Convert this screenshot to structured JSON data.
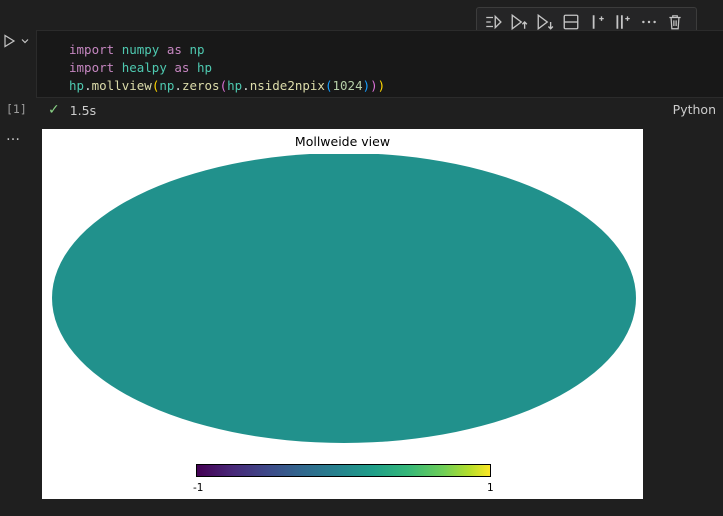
{
  "toolbar": {
    "icons": [
      "run-by-line-icon",
      "run-above-icon",
      "run-below-icon",
      "split-cell-icon",
      "add-cell-above-icon",
      "add-cell-below-icon",
      "more-icon",
      "delete-icon"
    ]
  },
  "cell": {
    "code_lines": [
      "import numpy as np",
      "import healpy as hp",
      "hp.mollview(np.zeros(hp.nside2npix(1024)))"
    ],
    "execution_count": "[1]",
    "duration": "1.5s",
    "language": "Python",
    "more": "…"
  },
  "output": {
    "title": "Mollweide view",
    "map_color": "#21918c",
    "colorbar_min": "-1",
    "colorbar_max": "1"
  }
}
